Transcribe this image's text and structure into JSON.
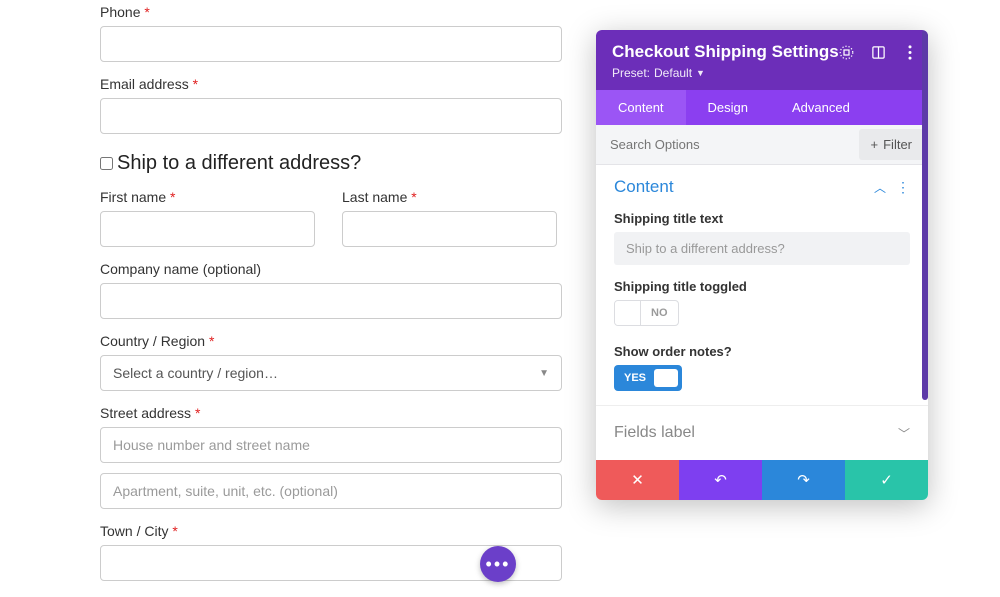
{
  "form": {
    "phone_label": "Phone",
    "email_label": "Email address",
    "ship_heading": "Ship to a different address?",
    "first_name_label": "First name",
    "last_name_label": "Last name",
    "company_label": "Company name (optional)",
    "country_label": "Country / Region",
    "country_placeholder": "Select a country / region…",
    "street_label": "Street address",
    "street1_placeholder": "House number and street name",
    "street2_placeholder": "Apartment, suite, unit, etc. (optional)",
    "city_label": "Town / City",
    "required_mark": "*"
  },
  "panel": {
    "title": "Checkout Shipping Settings",
    "preset_label": "Preset:",
    "preset_value": "Default",
    "tabs": {
      "content": "Content",
      "design": "Design",
      "advanced": "Advanced"
    },
    "search_placeholder": "Search Options",
    "filter_label": "Filter",
    "section_content": "Content",
    "opt_title_text_label": "Shipping title text",
    "opt_title_text_value": "Ship to a different address?",
    "opt_title_toggled_label": "Shipping title toggled",
    "opt_title_toggled_value": "NO",
    "opt_show_notes_label": "Show order notes?",
    "opt_show_notes_value": "YES",
    "section_fields": "Fields label"
  }
}
